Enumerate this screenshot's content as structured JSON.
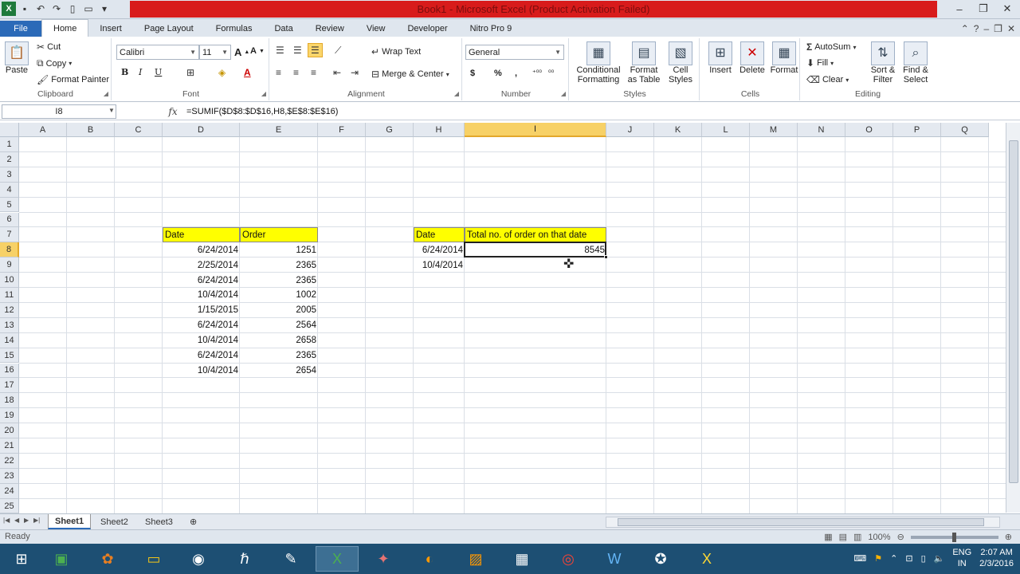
{
  "window": {
    "title": "Book1  -  Microsoft Excel (Product Activation Failed)"
  },
  "ribbon": {
    "tabs": [
      "File",
      "Home",
      "Insert",
      "Page Layout",
      "Formulas",
      "Data",
      "Review",
      "View",
      "Developer",
      "Nitro Pro 9"
    ],
    "active_tab": "Home",
    "clipboard": {
      "paste": "Paste",
      "cut": "Cut",
      "copy": "Copy",
      "format_painter": "Format Painter",
      "label": "Clipboard"
    },
    "font": {
      "name": "Calibri",
      "size": "11",
      "label": "Font",
      "bold": "B",
      "italic": "I",
      "underline": "U"
    },
    "alignment": {
      "wrap_text": "Wrap Text",
      "merge_center": "Merge & Center",
      "label": "Alignment"
    },
    "number": {
      "format": "General",
      "label": "Number",
      "currency": "$",
      "percent": "%",
      "comma": ","
    },
    "styles": {
      "conditional_formatting": "Conditional\nFormatting",
      "format_as_table": "Format\nas Table",
      "cell_styles": "Cell\nStyles",
      "label": "Styles"
    },
    "cells": {
      "insert": "Insert",
      "delete": "Delete",
      "format": "Format",
      "label": "Cells"
    },
    "editing": {
      "autosum": "AutoSum",
      "fill": "Fill",
      "clear": "Clear",
      "sort_filter": "Sort &\nFilter",
      "find_select": "Find &\nSelect",
      "label": "Editing"
    }
  },
  "formula_bar": {
    "name_box": "I8",
    "fx": "fx",
    "formula": "=SUMIF($D$8:$D$16,H8,$E$8:$E$16)"
  },
  "sheet": {
    "columns": [
      "A",
      "B",
      "C",
      "D",
      "E",
      "F",
      "G",
      "H",
      "I",
      "J",
      "K",
      "L",
      "M",
      "N",
      "O",
      "P",
      "Q"
    ],
    "rows": [
      "1",
      "2",
      "3",
      "4",
      "5",
      "6",
      "7",
      "8",
      "9",
      "10",
      "11",
      "12",
      "13",
      "14",
      "15",
      "16",
      "17",
      "18",
      "19",
      "20",
      "21",
      "22",
      "23",
      "24",
      "25"
    ],
    "active_column": "I",
    "active_row": "8",
    "table1": {
      "headers": [
        "Date",
        "Order"
      ],
      "rows": [
        [
          "6/24/2014",
          "1251"
        ],
        [
          "2/25/2014",
          "2365"
        ],
        [
          "6/24/2014",
          "2365"
        ],
        [
          "10/4/2014",
          "1002"
        ],
        [
          "1/15/2015",
          "2005"
        ],
        [
          "6/24/2014",
          "2564"
        ],
        [
          "10/4/2014",
          "2658"
        ],
        [
          "6/24/2014",
          "2365"
        ],
        [
          "10/4/2014",
          "2654"
        ]
      ]
    },
    "table2": {
      "headers": [
        "Date",
        "Total no. of order on that date"
      ],
      "rows": [
        [
          "6/24/2014",
          "8545"
        ],
        [
          "10/4/2014",
          ""
        ]
      ]
    },
    "highlight_color": "#ffff00"
  },
  "sheet_tabs": [
    "Sheet1",
    "Sheet2",
    "Sheet3"
  ],
  "active_sheet": "Sheet1",
  "status": {
    "ready": "Ready",
    "zoom": "100%"
  },
  "taskbar": {
    "clock_time": "2:07 AM",
    "clock_date": "2/3/2016",
    "lang_top": "ENG",
    "lang_bottom": "IN"
  }
}
